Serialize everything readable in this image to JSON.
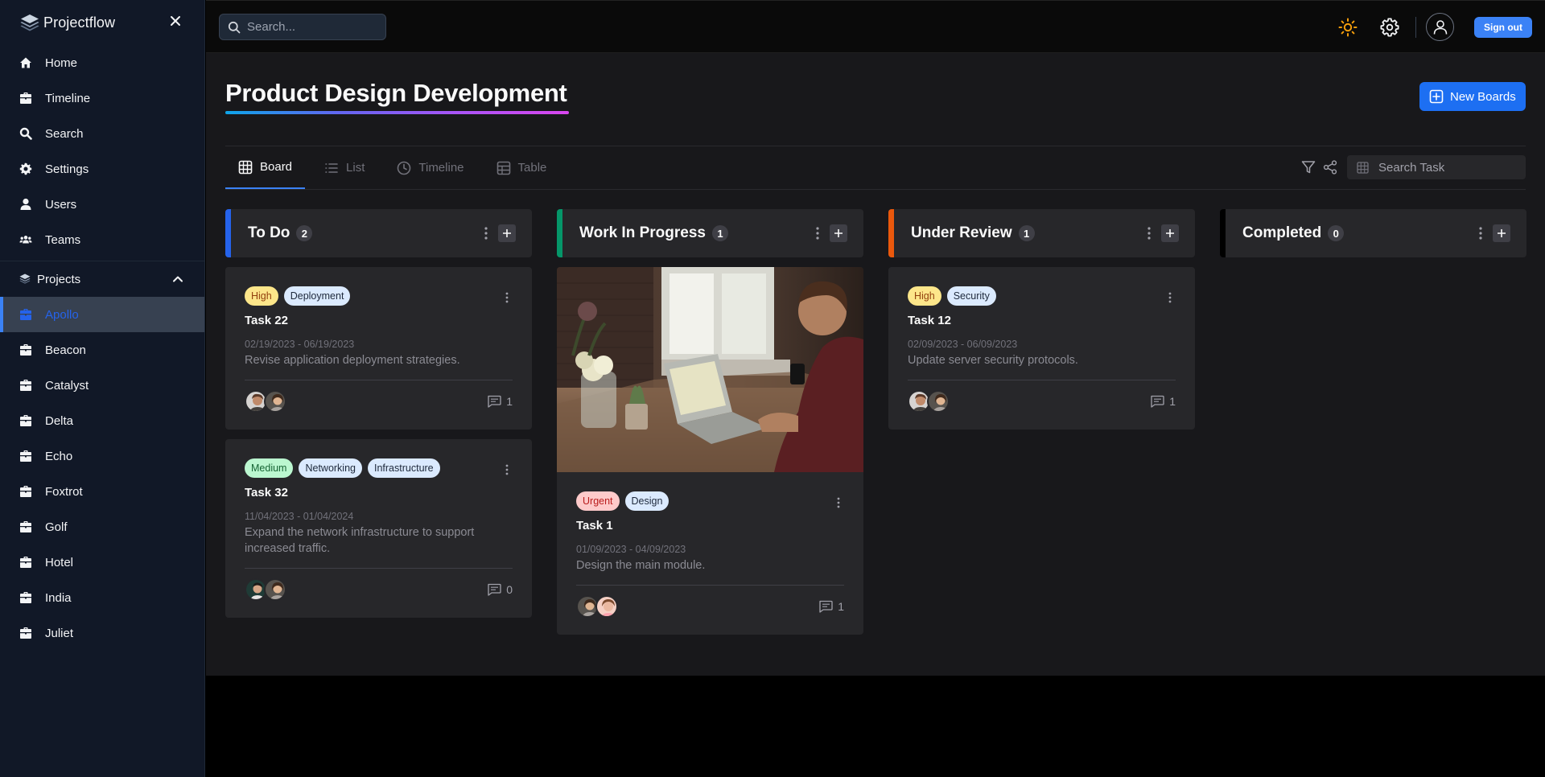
{
  "app": {
    "name": "Projectflow"
  },
  "sidebar": {
    "nav": [
      {
        "label": "Home",
        "icon": "home-icon"
      },
      {
        "label": "Timeline",
        "icon": "briefcase-icon"
      },
      {
        "label": "Search",
        "icon": "search-icon"
      },
      {
        "label": "Settings",
        "icon": "gear-icon"
      },
      {
        "label": "Users",
        "icon": "user-icon"
      },
      {
        "label": "Teams",
        "icon": "users-icon"
      }
    ],
    "projects_label": "Projects",
    "projects": [
      {
        "label": "Apollo",
        "active": true
      },
      {
        "label": "Beacon"
      },
      {
        "label": "Catalyst"
      },
      {
        "label": "Delta"
      },
      {
        "label": "Echo"
      },
      {
        "label": "Foxtrot"
      },
      {
        "label": "Golf"
      },
      {
        "label": "Hotel"
      },
      {
        "label": "India"
      },
      {
        "label": "Juliet"
      }
    ]
  },
  "topbar": {
    "search_placeholder": "Search...",
    "sign_out": "Sign out"
  },
  "main": {
    "title": "Product Design Development",
    "new_boards": "New Boards",
    "tabs": [
      "Board",
      "List",
      "Timeline",
      "Table"
    ],
    "active_tab": "Board",
    "task_search_placeholder": "Search Task"
  },
  "columns": [
    {
      "title": "To Do",
      "count": "2",
      "accent": "#2563eb",
      "cards": [
        {
          "priority": "High",
          "tags": [
            "Deployment"
          ],
          "name": "Task 22",
          "dates": "02/19/2023 - 06/19/2023",
          "desc": "Revise application deployment strategies.",
          "comments": "1"
        },
        {
          "priority": "Medium",
          "tags": [
            "Networking",
            "Infrastructure"
          ],
          "name": "Task 32",
          "dates": "11/04/2023 - 01/04/2024",
          "desc": "Expand the network infrastructure to support increased traffic.",
          "comments": "0"
        }
      ]
    },
    {
      "title": "Work In Progress",
      "count": "1",
      "accent": "#059669",
      "cards": [
        {
          "priority": "Urgent",
          "tags": [
            "Design"
          ],
          "name": "Task 1",
          "dates": "01/09/2023 - 04/09/2023",
          "desc": "Design the main module.",
          "comments": "1"
        }
      ]
    },
    {
      "title": "Under Review",
      "count": "1",
      "accent": "#ea580c",
      "cards": [
        {
          "priority": "High",
          "tags": [
            "Security"
          ],
          "name": "Task 12",
          "dates": "02/09/2023 - 06/09/2023",
          "desc": "Update server security protocols.",
          "comments": "1"
        }
      ]
    },
    {
      "title": "Completed",
      "count": "0",
      "accent": "#000000",
      "cards": []
    }
  ],
  "colors": {
    "primary": "#1d6ff2",
    "sidebar_bg": "#111827",
    "main_bg": "#18181b",
    "card_bg": "#27272a"
  }
}
